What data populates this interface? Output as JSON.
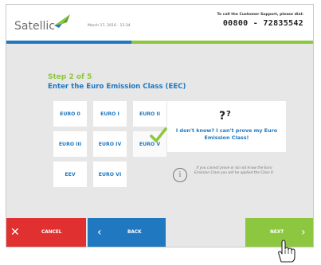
{
  "header": {
    "logo_text": "Satellic",
    "datetime": "March 17, 2016 - 12:34",
    "support_text": "To call the Customer Support, please dial:",
    "support_phone": "00800 - 72835542"
  },
  "step": {
    "title": "Step 2 of 5",
    "subtitle": "Enter the Euro Emission Class (EEC)"
  },
  "emission_classes": [
    "EURO 0",
    "EURO I",
    "EURO II",
    "EURO III",
    "EURO IV",
    "EURO V",
    "EEV",
    "EURO VI"
  ],
  "selected_class": "EURO V",
  "dont_know": {
    "label": "I don't know? I can't prove my Euro Emission Class!"
  },
  "info": {
    "text": "If you cannot prove or do not know the Euro Emission Class you will be applied the Class 0."
  },
  "footer": {
    "cancel_label": "CANCEL",
    "back_label": "BACK",
    "next_label": "NEXT"
  },
  "colors": {
    "brand_blue": "#1f78c0",
    "brand_green": "#8dc63f",
    "cancel_red": "#e03030",
    "panel_grey": "#e7e7e7"
  }
}
